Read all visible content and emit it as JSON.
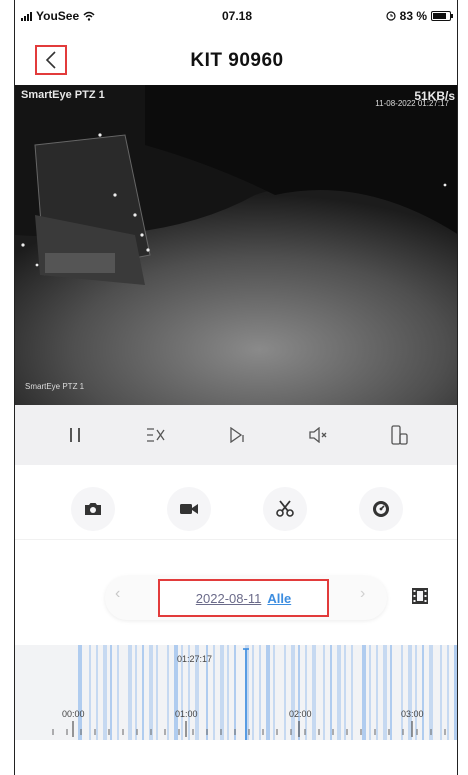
{
  "status_bar": {
    "carrier": "YouSee",
    "time": "07.18",
    "battery": "83 %",
    "battery_level": 0.83
  },
  "nav": {
    "title": "KIT 90960",
    "back_icon": "chevron-left-icon"
  },
  "video": {
    "camera_name": "SmartEye PTZ 1",
    "bitrate": "51KB/s",
    "osd_timestamp": "11-08-2022 01:27:17",
    "osd_camera": "SmartEye PTZ 1"
  },
  "playback_controls": [
    {
      "name": "pause-icon"
    },
    {
      "name": "speed-icon"
    },
    {
      "name": "step-forward-icon"
    },
    {
      "name": "mute-icon"
    },
    {
      "name": "rotate-screen-icon"
    }
  ],
  "actions": [
    {
      "name": "camera-icon"
    },
    {
      "name": "video-record-icon"
    },
    {
      "name": "scissors-icon"
    },
    {
      "name": "speedometer-icon"
    }
  ],
  "date_selector": {
    "date": "2022-08-11",
    "filter": "Alle",
    "prev": "‹",
    "next": "›"
  },
  "timeline": {
    "current_time": "01:27:17",
    "labels": [
      "00:00",
      "01:00",
      "02:00",
      "03:00"
    ]
  },
  "colors": {
    "accent": "#3c8de0",
    "highlight": "#e23b3b",
    "timeline_bar": "#a9c8ee"
  }
}
